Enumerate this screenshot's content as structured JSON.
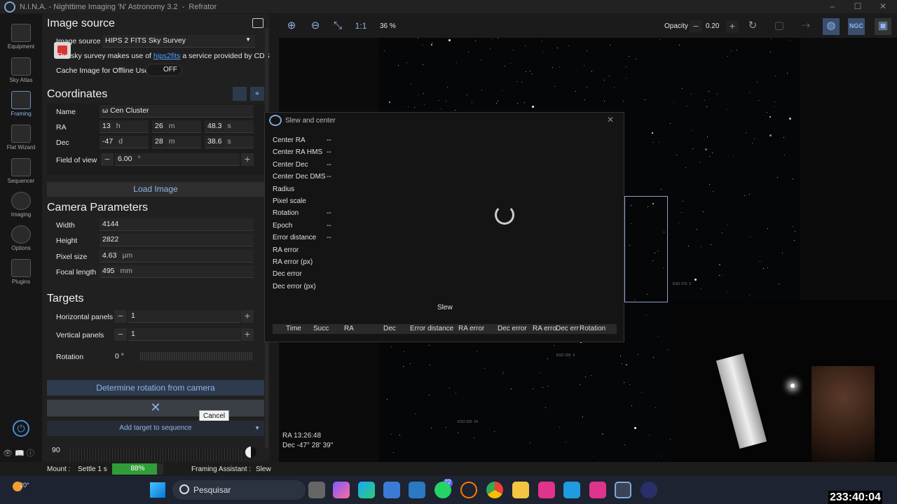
{
  "window": {
    "title": "N.I.N.A. - Nighttime Imaging 'N' Astronomy 3.2",
    "profile": "Refrator"
  },
  "sidebar": {
    "items": [
      {
        "label": "Equipment"
      },
      {
        "label": "Sky Atlas"
      },
      {
        "label": "Framing"
      },
      {
        "label": "Flat Wizard"
      },
      {
        "label": "Sequencer"
      },
      {
        "label": "Imaging"
      },
      {
        "label": "Options"
      },
      {
        "label": "Plugins"
      }
    ],
    "collapse": "<<"
  },
  "image_source": {
    "heading": "Image source",
    "label": "Image source",
    "value": "HIPS 2 FITS Sky Survey",
    "note_prefix": "The sky survey makes use of ",
    "note_link": "hips2fits",
    "note_suffix": " a service provided by CDS",
    "cache_label": "Cache Image for Offline Use",
    "cache_state": "OFF"
  },
  "coordinates": {
    "heading": "Coordinates",
    "name_label": "Name",
    "name": "ω Cen Cluster",
    "ra_label": "RA",
    "ra_h": "13",
    "ra_h_unit": "h",
    "ra_m": "26",
    "ra_m_unit": "m",
    "ra_s": "48.3",
    "ra_s_unit": "s",
    "dec_label": "Dec",
    "dec_d": "-47",
    "dec_d_unit": "d",
    "dec_m": "28",
    "dec_m_unit": "m",
    "dec_s": "38.6",
    "dec_s_unit": "s",
    "fov_label": "Field of view",
    "fov": "6.00",
    "fov_unit": "°",
    "load_button": "Load Image"
  },
  "camera": {
    "heading": "Camera Parameters",
    "width_label": "Width",
    "width": "4144",
    "height_label": "Height",
    "height": "2822",
    "pixel_label": "Pixel size",
    "pixel": "4.63",
    "pixel_unit": "µm",
    "focal_label": "Focal length",
    "focal": "495",
    "focal_unit": "mm"
  },
  "targets": {
    "heading": "Targets",
    "hpanels_label": "Horizontal panels",
    "hpanels": "1",
    "vpanels_label": "Vertical panels",
    "vpanels": "1",
    "rotation_label": "Rotation",
    "rotation": "0",
    "rotation_unit": "°",
    "determine_button": "Determine rotation from camera",
    "cancel_tooltip": "Cancel",
    "add_button": "Add target to sequence",
    "angle_value": "90"
  },
  "sky_toolbar": {
    "zoom": "36 %",
    "one_to_one": "1:1",
    "opacity_label": "Opacity",
    "opacity": "0.20",
    "ngc": "NGC"
  },
  "sky_readout": {
    "ra": "RA  13:26:48",
    "dec": "Dec  -47° 28' 39\""
  },
  "sky_labels": [
    "ESO 270- 2",
    "ESO 220- 3",
    "ESO 220- 24"
  ],
  "dialog": {
    "title": "Slew and center",
    "rows": [
      {
        "label": "Center RA",
        "value": "--"
      },
      {
        "label": "Center RA HMS",
        "value": "--"
      },
      {
        "label": "Center Dec",
        "value": "--"
      },
      {
        "label": "Center Dec DMS",
        "value": "--"
      },
      {
        "label": "Radius",
        "value": ""
      },
      {
        "label": "Pixel scale",
        "value": ""
      },
      {
        "label": "Rotation",
        "value": "--"
      },
      {
        "label": "Epoch",
        "value": "--"
      },
      {
        "label": "Error distance",
        "value": "--"
      },
      {
        "label": "RA error",
        "value": ""
      },
      {
        "label": "RA error (px)",
        "value": ""
      },
      {
        "label": "Dec error",
        "value": ""
      },
      {
        "label": "Dec error (px)",
        "value": ""
      }
    ],
    "status": "Slew",
    "columns": [
      "Time",
      "Succ",
      "RA",
      "Dec",
      "Error distance",
      "RA error",
      "Dec error",
      "RA erro",
      "Dec err",
      "Rotation"
    ]
  },
  "statusbar": {
    "mount_label": "Mount :",
    "mount_status": "Settle 1 s",
    "progress_text": "88%",
    "progress": 0.88,
    "framing_label": "Framing Assistant :",
    "framing_status": "Slew"
  },
  "taskbar": {
    "weather": "20°",
    "search_placeholder": "Pesquisar",
    "badge": "22"
  },
  "overlay": {
    "timer": "233:40:04"
  }
}
